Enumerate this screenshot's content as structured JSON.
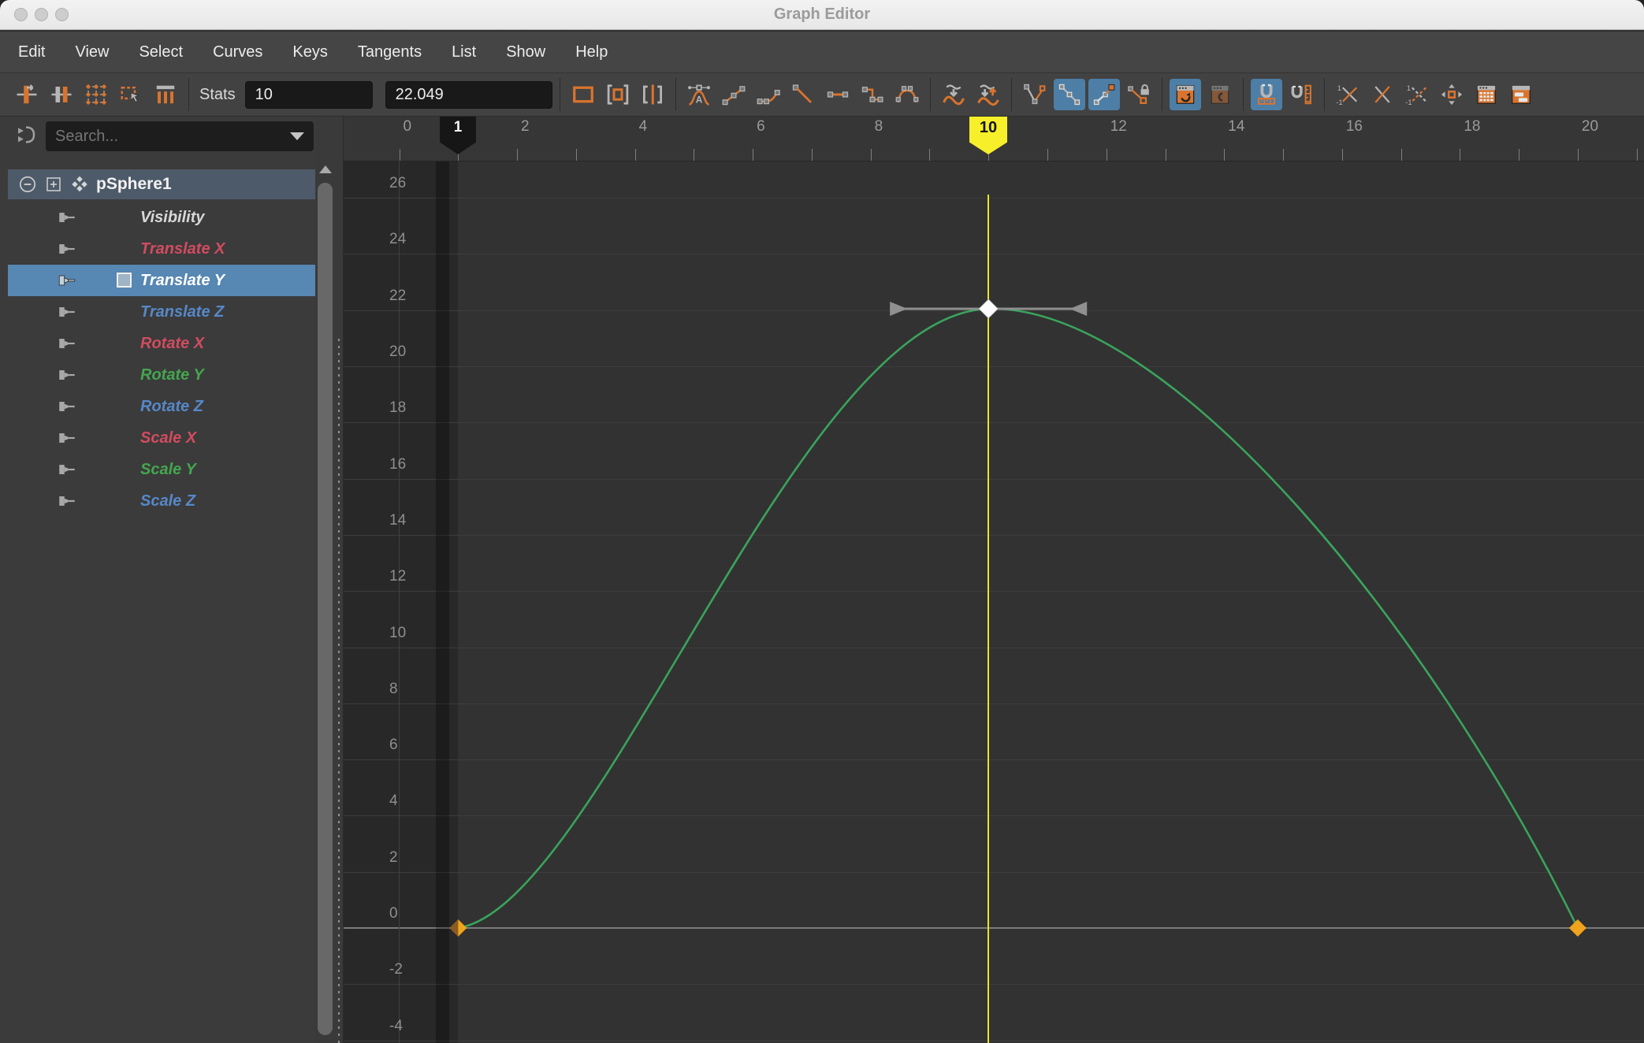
{
  "window": {
    "title": "Graph Editor",
    "traffic_lights": [
      "close",
      "minimize",
      "zoom"
    ]
  },
  "menu": {
    "items": [
      "Edit",
      "View",
      "Select",
      "Curves",
      "Keys",
      "Tangents",
      "List",
      "Show",
      "Help"
    ]
  },
  "toolbar": {
    "stats_label": "Stats",
    "stat_fields": [
      {
        "name": "selected-key-time",
        "value": "10"
      },
      {
        "name": "selected-key-value",
        "value": "22.049"
      }
    ],
    "groups": [
      {
        "type": "icons",
        "items": [
          {
            "name": "move-key-tool"
          },
          {
            "name": "insert-key-tool"
          },
          {
            "name": "lattice-deform-keys-tool"
          },
          {
            "name": "region-select-tool"
          },
          {
            "name": "retime-tool"
          }
        ]
      },
      {
        "type": "stats"
      },
      {
        "type": "icons",
        "items": [
          {
            "name": "frame-all"
          },
          {
            "name": "frame-playback-range"
          },
          {
            "name": "center-current-time"
          }
        ]
      },
      {
        "type": "icons",
        "items": [
          {
            "name": "auto-tangent"
          },
          {
            "name": "spline-tangent"
          },
          {
            "name": "clamped-tangent"
          },
          {
            "name": "linear-tangent"
          },
          {
            "name": "flat-tangent"
          },
          {
            "name": "step-tangent"
          },
          {
            "name": "plateau-tangent"
          }
        ]
      },
      {
        "type": "icons",
        "items": [
          {
            "name": "buffer-curve-snapshot"
          },
          {
            "name": "swap-buffer-curve"
          }
        ]
      },
      {
        "type": "icons",
        "items": [
          {
            "name": "break-tangents"
          },
          {
            "name": "unify-tangents",
            "active": true
          },
          {
            "name": "free-tangent-weight",
            "active": true
          },
          {
            "name": "lock-tangent-weight"
          }
        ]
      },
      {
        "type": "icons",
        "items": [
          {
            "name": "auto-load-graph-editor",
            "active": true
          },
          {
            "name": "load-upcoming-objects",
            "dimmed": true
          }
        ]
      },
      {
        "type": "icons",
        "items": [
          {
            "name": "time-snap",
            "active": true
          },
          {
            "name": "value-snap"
          }
        ]
      },
      {
        "type": "icons",
        "items": [
          {
            "name": "scale-keys-negative-time"
          },
          {
            "name": "swap-keys"
          },
          {
            "name": "scale-keys-negative-value"
          },
          {
            "name": "move-keys-tool"
          },
          {
            "name": "spreadsheet"
          },
          {
            "name": "dope-sheet"
          }
        ]
      }
    ],
    "highlight_color": "#4d7ea6",
    "icon_orange": "#d9742e"
  },
  "sidebar": {
    "search_placeholder": "Search...",
    "node": {
      "label": "pSphere1",
      "expanded": true
    },
    "channels": [
      {
        "label": "Visibility",
        "color": "#d8d8d8",
        "selected": false
      },
      {
        "label": "Translate X",
        "color": "#d14c60",
        "selected": false
      },
      {
        "label": "Translate Y",
        "color": "#ffffff",
        "selected": true
      },
      {
        "label": "Translate Z",
        "color": "#5688c8",
        "selected": false
      },
      {
        "label": "Rotate X",
        "color": "#d14c60",
        "selected": false
      },
      {
        "label": "Rotate Y",
        "color": "#44a64f",
        "selected": false
      },
      {
        "label": "Rotate Z",
        "color": "#5688c8",
        "selected": false
      },
      {
        "label": "Scale X",
        "color": "#d14c60",
        "selected": false
      },
      {
        "label": "Scale Y",
        "color": "#44a64f",
        "selected": false
      },
      {
        "label": "Scale Z",
        "color": "#5688c8",
        "selected": false
      }
    ]
  },
  "graph": {
    "ruler_labels": [
      0,
      2,
      4,
      6,
      8,
      12,
      14,
      16,
      18,
      20
    ],
    "value_axis_labels": [
      26,
      24,
      22,
      20,
      18,
      16,
      14,
      12,
      10,
      8,
      6,
      4,
      2,
      0,
      -2,
      -4
    ],
    "range_start_marker": {
      "label": "1",
      "frame": 1
    },
    "current_time_marker": {
      "label": "10",
      "frame": 10,
      "color": "#f7ef2a"
    },
    "curve": {
      "attribute": "Translate Y",
      "color": "#3aa35c",
      "keys": [
        {
          "frame": 1,
          "value": 0
        },
        {
          "frame": 10,
          "value": 22.049
        },
        {
          "frame": 20,
          "value": 0
        }
      ],
      "selected_key_index": 1,
      "selected_key_tangent": "flat",
      "key_color": "#f0a41d",
      "selected_key_color": "#fdfdfd"
    }
  }
}
